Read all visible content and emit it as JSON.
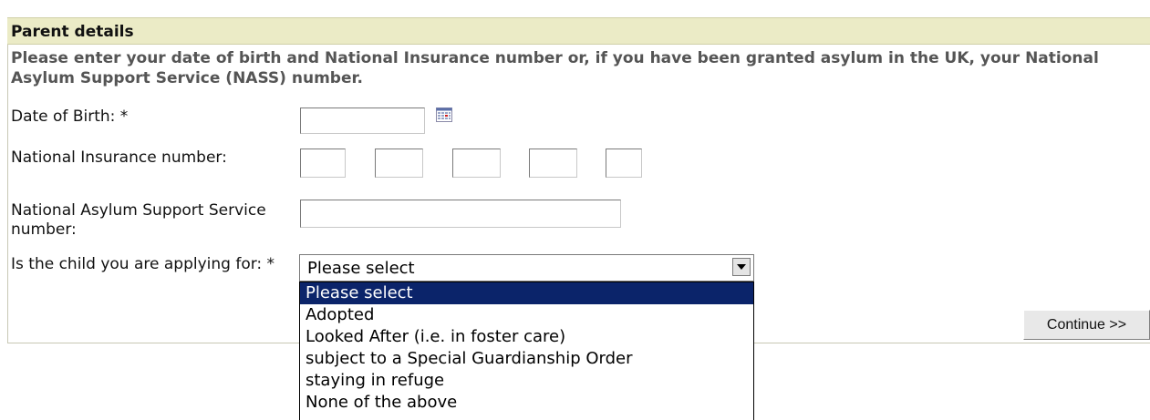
{
  "section": {
    "title": "Parent details",
    "instructions": "Please enter your date of birth and National Insurance number or, if you have been granted asylum in the UK, your National Asylum Support Service (NASS) number."
  },
  "fields": {
    "dob_label": "Date of Birth: *",
    "ni_label": "National Insurance number:",
    "nass_label": "National Asylum Support Service number:",
    "child_label": "Is the child you are applying for: *"
  },
  "icons": {
    "calendar": "calendar-icon",
    "dropdown_arrow": "chevron-down-icon"
  },
  "select": {
    "value": "Please select",
    "options": [
      "Please select",
      "Adopted",
      "Looked After (i.e. in foster care)",
      "subject to a Special Guardianship Order",
      "staying in refuge",
      "None of the above"
    ],
    "highlighted_index": 0
  },
  "buttons": {
    "continue": "Continue >>"
  },
  "colors": {
    "header_bg": "#ebebc6",
    "highlight": "#0b246a"
  }
}
